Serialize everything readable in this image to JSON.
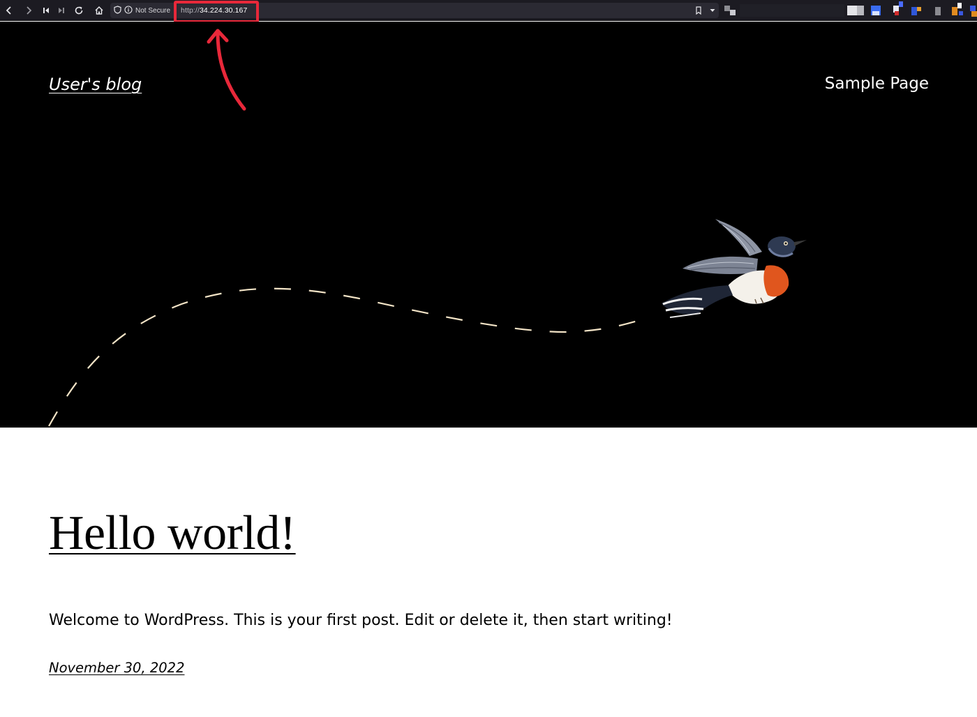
{
  "browser": {
    "security_label": "Not Secure",
    "url_scheme": "http://",
    "url_host": "34.224.30.167",
    "icons": [
      "back-icon",
      "forward-icon",
      "skip-back-icon",
      "skip-forward-icon",
      "reload-icon",
      "home-icon",
      "shield-icon",
      "info-icon",
      "bookmark-icon",
      "dropdown-icon"
    ]
  },
  "site": {
    "title": "User's blog",
    "nav": [
      {
        "label": "Sample Page"
      }
    ]
  },
  "post": {
    "title": "Hello world!",
    "excerpt": "Welcome to WordPress. This is your first post. Edit or delete it, then start writing!",
    "date": "November 30, 2022"
  },
  "colors": {
    "hero_bg": "#000000",
    "annotation": "#e8283a",
    "toolbar_bg": "#1c1b22"
  }
}
